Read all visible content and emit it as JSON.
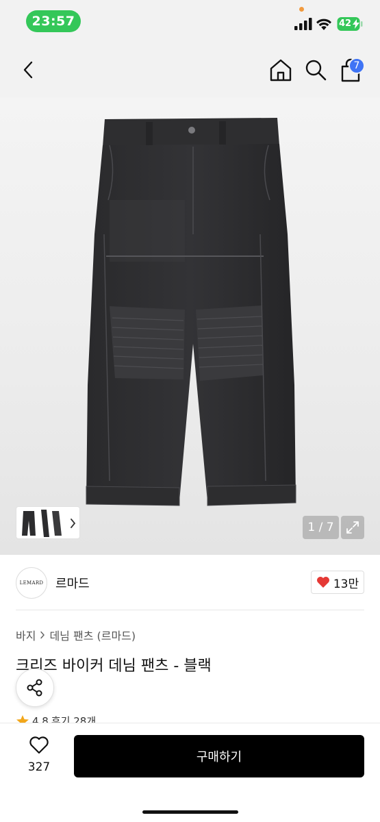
{
  "status_bar": {
    "time": "23:57",
    "battery": "42"
  },
  "nav": {
    "cart_count": "7"
  },
  "gallery": {
    "page_indicator": "1 / 7"
  },
  "brand": {
    "logo_text": "LEMARD",
    "name": "르마드",
    "likes": "13만"
  },
  "breadcrumb": {
    "category": "바지",
    "subcategory": "데님 팬츠 (르마드)"
  },
  "product": {
    "title": "크리즈 바이커 데님 팬츠 - 블랙",
    "rating": "4.8",
    "reviews": "후기 28개"
  },
  "bottom": {
    "wish_count": "327",
    "buy_label": "구매하기"
  },
  "colors": {
    "accent_green": "#34c759",
    "badge_blue": "#3f74f5",
    "heart_red": "#e53935",
    "button_black": "#000000"
  }
}
